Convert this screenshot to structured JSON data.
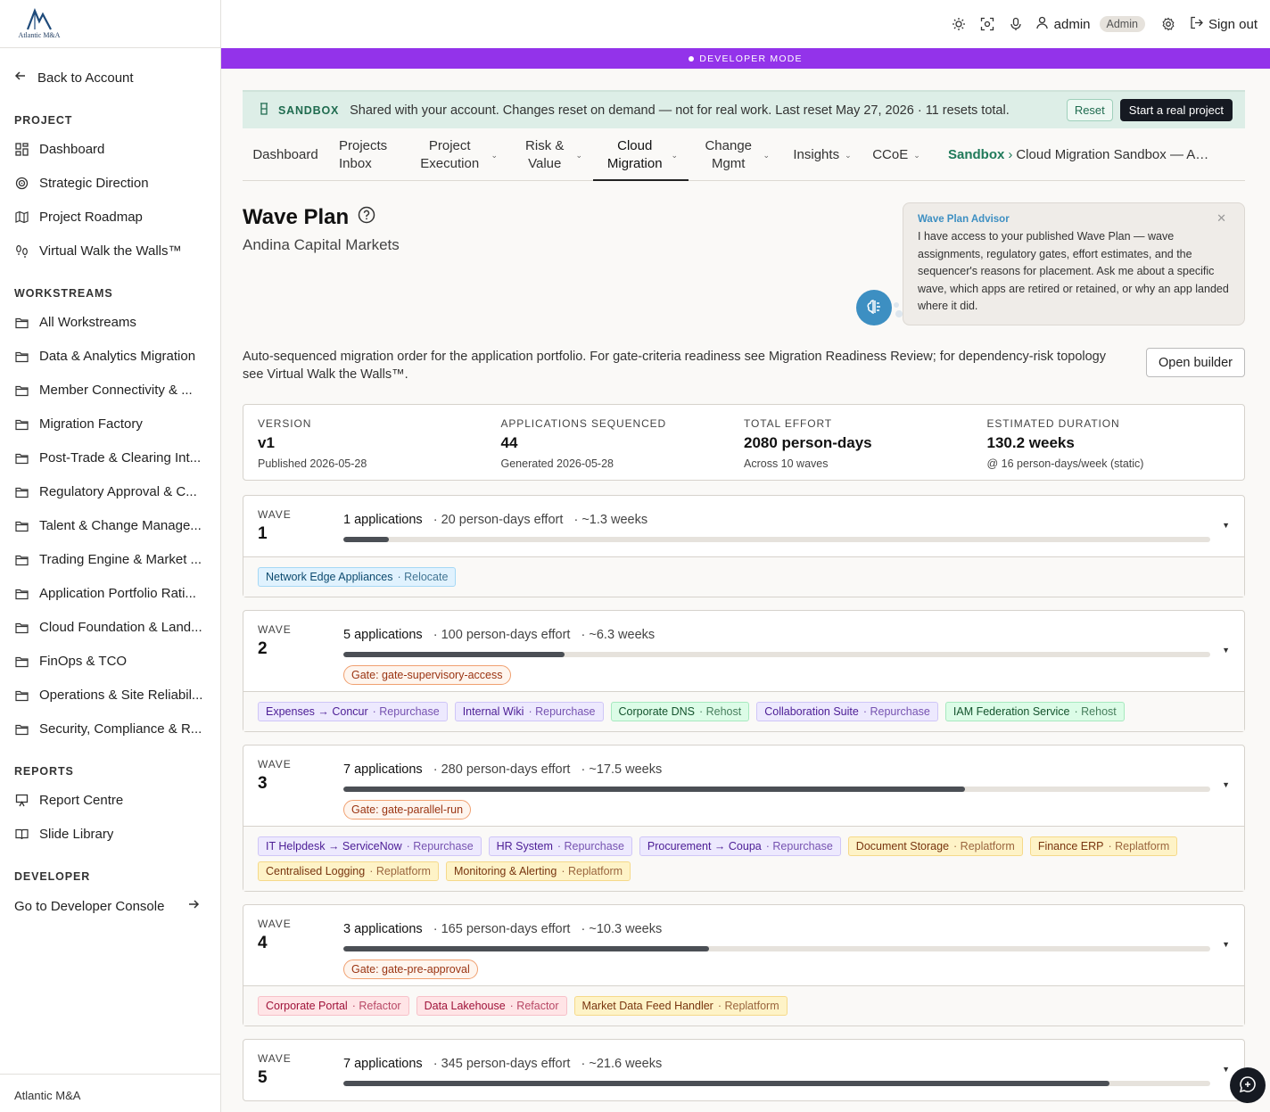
{
  "brand": {
    "logo_text": "Atlantic M&A",
    "footer": "Atlantic M&A"
  },
  "sidebar": {
    "back_label": "Back to Account",
    "project_heading": "PROJECT",
    "project_items": [
      {
        "label": "Dashboard",
        "icon": "dashboard-icon"
      },
      {
        "label": "Strategic Direction",
        "icon": "target-icon"
      },
      {
        "label": "Project Roadmap",
        "icon": "map-icon"
      },
      {
        "label": "Virtual Walk the Walls™",
        "icon": "footprints-icon"
      }
    ],
    "workstreams_heading": "WORKSTREAMS",
    "workstream_items": [
      "All Workstreams",
      "Data & Analytics Migration",
      "Member Connectivity & ...",
      "Migration Factory",
      "Post-Trade & Clearing Int...",
      "Regulatory Approval & C...",
      "Talent & Change Manage...",
      "Trading Engine & Market ...",
      "Application Portfolio Rati...",
      "Cloud Foundation & Land...",
      "FinOps & TCO",
      "Operations & Site Reliabil...",
      "Security, Compliance & R..."
    ],
    "reports_heading": "REPORTS",
    "report_items": [
      {
        "label": "Report Centre",
        "icon": "presentation-icon"
      },
      {
        "label": "Slide Library",
        "icon": "book-icon"
      }
    ],
    "developer_heading": "DEVELOPER",
    "developer_link": "Go to Developer Console"
  },
  "topbar": {
    "username": "admin",
    "role": "Admin",
    "signout": "Sign out",
    "icons": [
      "sun-icon",
      "focus-icon",
      "microphone-icon",
      "user-icon",
      "gear-icon",
      "sign-out-icon"
    ]
  },
  "devbar": {
    "label": "DEVELOPER MODE",
    "color": "#9333ea"
  },
  "sandbox": {
    "label": "SANDBOX",
    "message": "Shared with your account. Changes reset on demand — not for real work. Last reset May 27, 2026 · 11 resets total.",
    "reset_label": "Reset",
    "real_label": "Start a real project"
  },
  "tabs": [
    {
      "label": "Dashboard",
      "dropdown": false,
      "active": false
    },
    {
      "label": "Projects Inbox",
      "dropdown": false,
      "active": false
    },
    {
      "label": "Project Execution",
      "dropdown": true,
      "active": false
    },
    {
      "label": "Risk & Value",
      "dropdown": true,
      "active": false
    },
    {
      "label": "Cloud Migration",
      "dropdown": true,
      "active": true
    },
    {
      "label": "Change Mgmt",
      "dropdown": true,
      "active": false
    },
    {
      "label": "Insights",
      "dropdown": true,
      "active": false
    },
    {
      "label": "CCoE",
      "dropdown": true,
      "active": false
    }
  ],
  "breadcrumb": {
    "root": "Sandbox",
    "separator": "›",
    "current": "Cloud Migration Sandbox — Andina Capital Markets"
  },
  "page": {
    "title": "Wave Plan",
    "subtitle": "Andina Capital Markets",
    "description": "Auto-sequenced migration order for the application portfolio. For gate-criteria readiness see Migration Readiness Review; for dependency-risk topology see Virtual Walk the Walls™.",
    "builder_label": "Open builder"
  },
  "advisor": {
    "title": "Wave Plan Advisor",
    "text": "I have access to your published Wave Plan — wave assignments, regulatory gates, effort estimates, and the sequencer's reasons for placement. Ask me about a specific wave, which apps are retired or retained, or why an app landed where it did."
  },
  "stats": [
    {
      "label": "VERSION",
      "value": "v1",
      "sub": "Published 2026-05-28"
    },
    {
      "label": "APPLICATIONS SEQUENCED",
      "value": "44",
      "sub": "Generated 2026-05-28"
    },
    {
      "label": "TOTAL EFFORT",
      "value": "2080 person-days",
      "sub": "Across 10 waves"
    },
    {
      "label": "ESTIMATED DURATION",
      "value": "130.2 weeks",
      "sub": "@ 16 person-days/week (static)"
    }
  ],
  "wave_label": "WAVE",
  "waves": [
    {
      "number": "1",
      "apps": "1 applications",
      "effort": "· 20 person-days effort",
      "weeks": "· ~1.3 weeks",
      "progress": 0.052,
      "gate": "",
      "items": [
        {
          "name": "Network Edge Appliances",
          "strategy": "· Relocate",
          "kind": "relocate"
        }
      ]
    },
    {
      "number": "2",
      "apps": "5 applications",
      "effort": "· 100 person-days effort",
      "weeks": "· ~6.3 weeks",
      "progress": 0.255,
      "gate": "Gate: gate-supervisory-access",
      "items": [
        {
          "name": "Expenses → Concur",
          "strategy": "· Repurchase",
          "kind": "repurchase"
        },
        {
          "name": "Internal Wiki",
          "strategy": "· Repurchase",
          "kind": "repurchase"
        },
        {
          "name": "Corporate DNS",
          "strategy": "· Rehost",
          "kind": "rehost"
        },
        {
          "name": "Collaboration Suite",
          "strategy": "· Repurchase",
          "kind": "repurchase"
        },
        {
          "name": "IAM Federation Service",
          "strategy": "· Rehost",
          "kind": "rehost"
        }
      ]
    },
    {
      "number": "3",
      "apps": "7 applications",
      "effort": "· 280 person-days effort",
      "weeks": "· ~17.5 weeks",
      "progress": 0.717,
      "gate": "Gate: gate-parallel-run",
      "items": [
        {
          "name": "IT Helpdesk → ServiceNow",
          "strategy": "· Repurchase",
          "kind": "repurchase"
        },
        {
          "name": "HR System",
          "strategy": "· Repurchase",
          "kind": "repurchase"
        },
        {
          "name": "Procurement → Coupa",
          "strategy": "· Repurchase",
          "kind": "repurchase"
        },
        {
          "name": "Document Storage",
          "strategy": "· Replatform",
          "kind": "replatform"
        },
        {
          "name": "Finance ERP",
          "strategy": "· Replatform",
          "kind": "replatform"
        },
        {
          "name": "Centralised Logging",
          "strategy": "· Replatform",
          "kind": "replatform"
        },
        {
          "name": "Monitoring & Alerting",
          "strategy": "· Replatform",
          "kind": "replatform"
        }
      ]
    },
    {
      "number": "4",
      "apps": "3 applications",
      "effort": "· 165 person-days effort",
      "weeks": "· ~10.3 weeks",
      "progress": 0.422,
      "gate": "Gate: gate-pre-approval",
      "items": [
        {
          "name": "Corporate Portal",
          "strategy": "· Refactor",
          "kind": "refactor"
        },
        {
          "name": "Data Lakehouse",
          "strategy": "· Refactor",
          "kind": "refactor"
        },
        {
          "name": "Market Data Feed Handler",
          "strategy": "· Replatform",
          "kind": "replatform"
        }
      ]
    },
    {
      "number": "5",
      "apps": "7 applications",
      "effort": "· 345 person-days effort",
      "weeks": "· ~21.6 weeks",
      "progress": 0.884,
      "gate": "",
      "items": []
    }
  ]
}
